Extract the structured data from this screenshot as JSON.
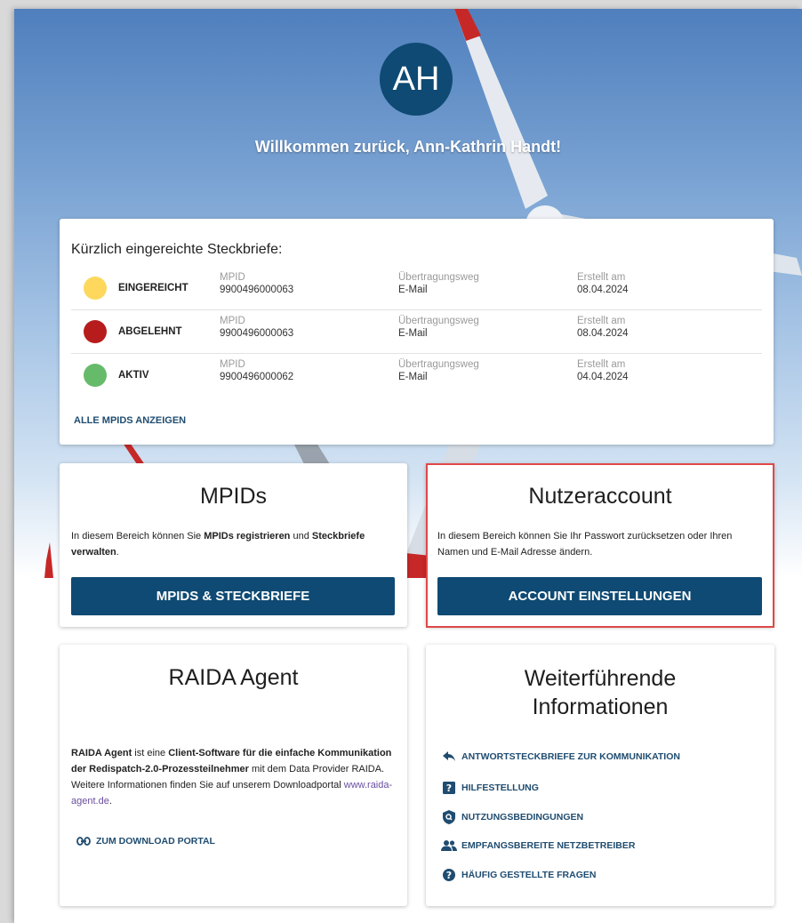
{
  "header": {
    "avatar_initials": "AH",
    "welcome": "Willkommen zurück, Ann-Kathrin Handt!"
  },
  "recent": {
    "title": "Kürzlich eingereichte Steckbriefe:",
    "rows": [
      {
        "status": "EINGEREICHT",
        "color": "#fdd85d",
        "mpid_label": "MPID",
        "mpid": "9900496000063",
        "channel_label": "Übertragungsweg",
        "channel": "E-Mail",
        "created_label": "Erstellt am",
        "created": "08.04.2024"
      },
      {
        "status": "ABGELEHNT",
        "color": "#b71c1c",
        "mpid_label": "MPID",
        "mpid": "9900496000063",
        "channel_label": "Übertragungsweg",
        "channel": "E-Mail",
        "created_label": "Erstellt am",
        "created": "08.04.2024"
      },
      {
        "status": "AKTIV",
        "color": "#66bb6a",
        "mpid_label": "MPID",
        "mpid": "9900496000062",
        "channel_label": "Übertragungsweg",
        "channel": "E-Mail",
        "created_label": "Erstellt am",
        "created": "04.04.2024"
      }
    ],
    "all_link": "ALLE MPIDS ANZEIGEN"
  },
  "mpids": {
    "title": "MPIDs",
    "text_pre": "In diesem Bereich können Sie ",
    "text_bold1": "MPIDs registrieren",
    "text_mid": " und ",
    "text_bold2": "Steckbriefe verwalten",
    "text_post": ".",
    "button": "MPIDS & STECKBRIEFE"
  },
  "account": {
    "title": "Nutzeraccount",
    "text": "In diesem Bereich können Sie Ihr Passwort zurücksetzen oder Ihren Namen und E-Mail Adresse ändern.",
    "button": "ACCOUNT EINSTELLUNGEN"
  },
  "agent": {
    "title": "RAIDA Agent",
    "bold1": "RAIDA Agent",
    "text1": " ist eine ",
    "bold2": "Client-Software für die einfache Kommunikation der Redispatch-2.0-Prozessteilnehmer",
    "text2": " mit dem Data Provider RAIDA. Weitere Informationen finden Sie auf unserem Downloadportal ",
    "link_text": "www.raida-agent.de",
    "text3": ".",
    "download": "ZUM DOWNLOAD PORTAL"
  },
  "info": {
    "title": "Weiterführende Informationen",
    "links": [
      {
        "label": "ANTWORTSTECKBRIEFE ZUR KOMMUNIKATION",
        "icon": "reply-icon"
      },
      {
        "label": "HILFESTELLUNG",
        "icon": "help-box-icon"
      },
      {
        "label": "NUTZUNGSBEDINGUNGEN",
        "icon": "shield-search-icon"
      },
      {
        "label": "EMPFANGSBEREITE NETZBETREIBER",
        "icon": "people-icon"
      },
      {
        "label": "HÄUFIG GESTELLTE FRAGEN",
        "icon": "question-circle-icon"
      }
    ]
  },
  "colors": {
    "primary": "#0e4a73",
    "link": "#1f4c70",
    "highlight": "#e04848"
  }
}
